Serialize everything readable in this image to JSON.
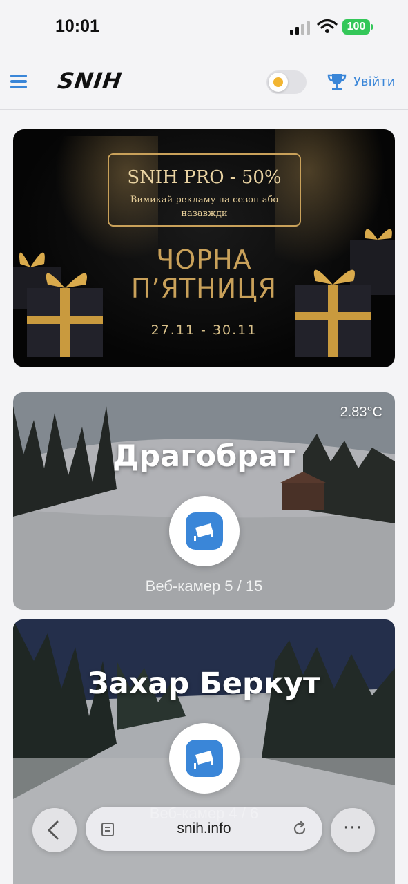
{
  "status_bar": {
    "time": "10:01",
    "battery": "100",
    "icons": [
      "signal-icon",
      "wifi-icon",
      "battery-icon"
    ]
  },
  "header": {
    "logo": "SNIH",
    "login_label": "Увійти",
    "icons": [
      "menu-icon",
      "sun-icon",
      "trophy-icon"
    ],
    "accent_color": "#3a86d8"
  },
  "promo": {
    "title": "SNIH PRO - 50%",
    "subtitle": "Вимикай рекламу на сезон або назавжди",
    "heading_line1": "ЧОРНА",
    "heading_line2": "П’ЯТНИЦЯ",
    "dates": "27.11 - 30.11",
    "gold_color": "#c9a15a"
  },
  "resorts": [
    {
      "name": "Драгобрат",
      "temperature": "2.83°C",
      "webcams": "Веб-камер 5 / 15"
    },
    {
      "name": "Захар Беркут",
      "webcams": "Веб-камер 4 / 6"
    }
  ],
  "browser": {
    "url": "snih.info",
    "more_label": "···",
    "icons": [
      "back-icon",
      "page-icon",
      "reload-icon",
      "more-icon"
    ]
  }
}
